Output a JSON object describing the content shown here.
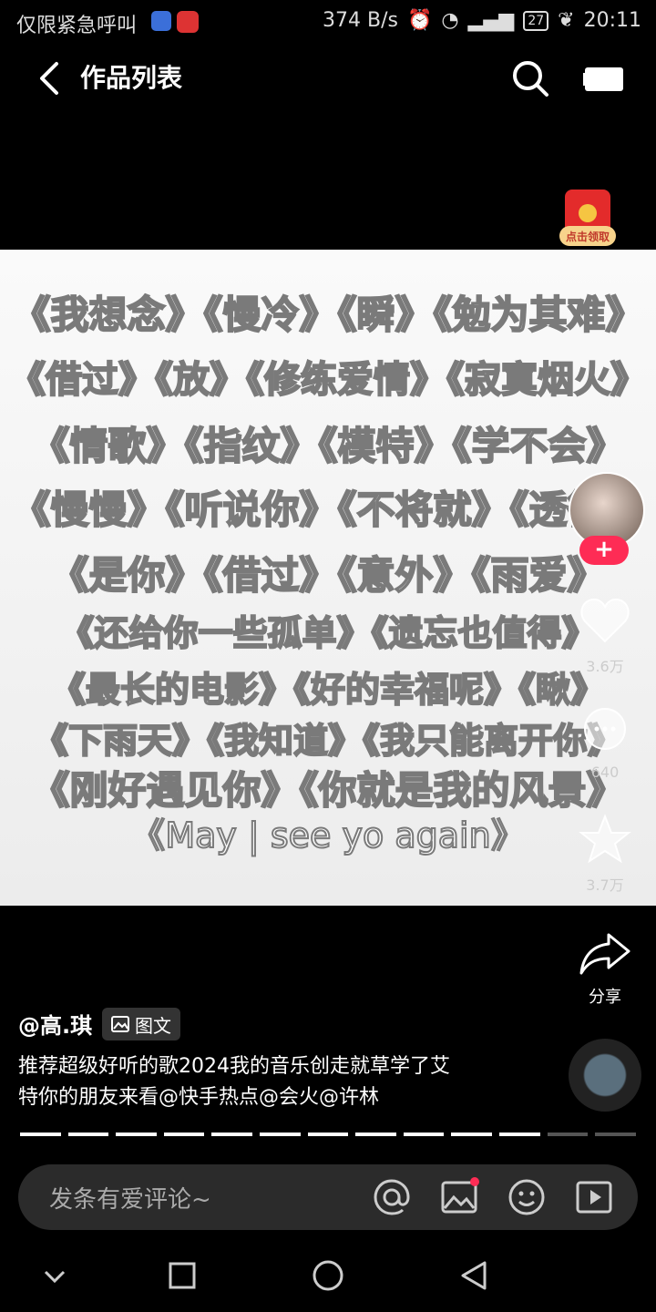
{
  "status_bar": {
    "left_text": "仅限紧急呼叫",
    "network_speed": "374 B/s",
    "battery": "27",
    "time": "20:11"
  },
  "header": {
    "title": "作品列表"
  },
  "red_packet": {
    "label": "点击领取"
  },
  "content_lines": [
    "《我想念》《慢冷》《瞬》《勉为其难》",
    "《借过》《放》《修练爱情》《寂寞烟火》",
    "《情歌》《指纹》《模特》《学不会》",
    "《慢慢》《听说你》《不将就》《透彻》",
    "《是你》《借过》《意外》《雨爱》",
    "《还给你一些孤单》《遗忘也值得》",
    "《最长的电影》《好的幸福呢》《瞅》",
    "《下雨天》《我知道》《我只能离开你》",
    "《刚好遇见你》《你就是我的风景》",
    "《May | see yo again》"
  ],
  "actions": {
    "like_count": "3.6万",
    "comment_count": "640",
    "favorite_count": "3.7万",
    "share_label": "分享"
  },
  "post": {
    "author": "@高.琪",
    "type_tag": "图文",
    "description_line1": "推荐超级好听的歌2024我的音乐创走就草学了艾",
    "description_line2": "特你的朋友来看@快手热点@会火@许林"
  },
  "progress": {
    "total": 13,
    "current": 11
  },
  "comment_bar": {
    "placeholder": "发条有爱评论~"
  }
}
